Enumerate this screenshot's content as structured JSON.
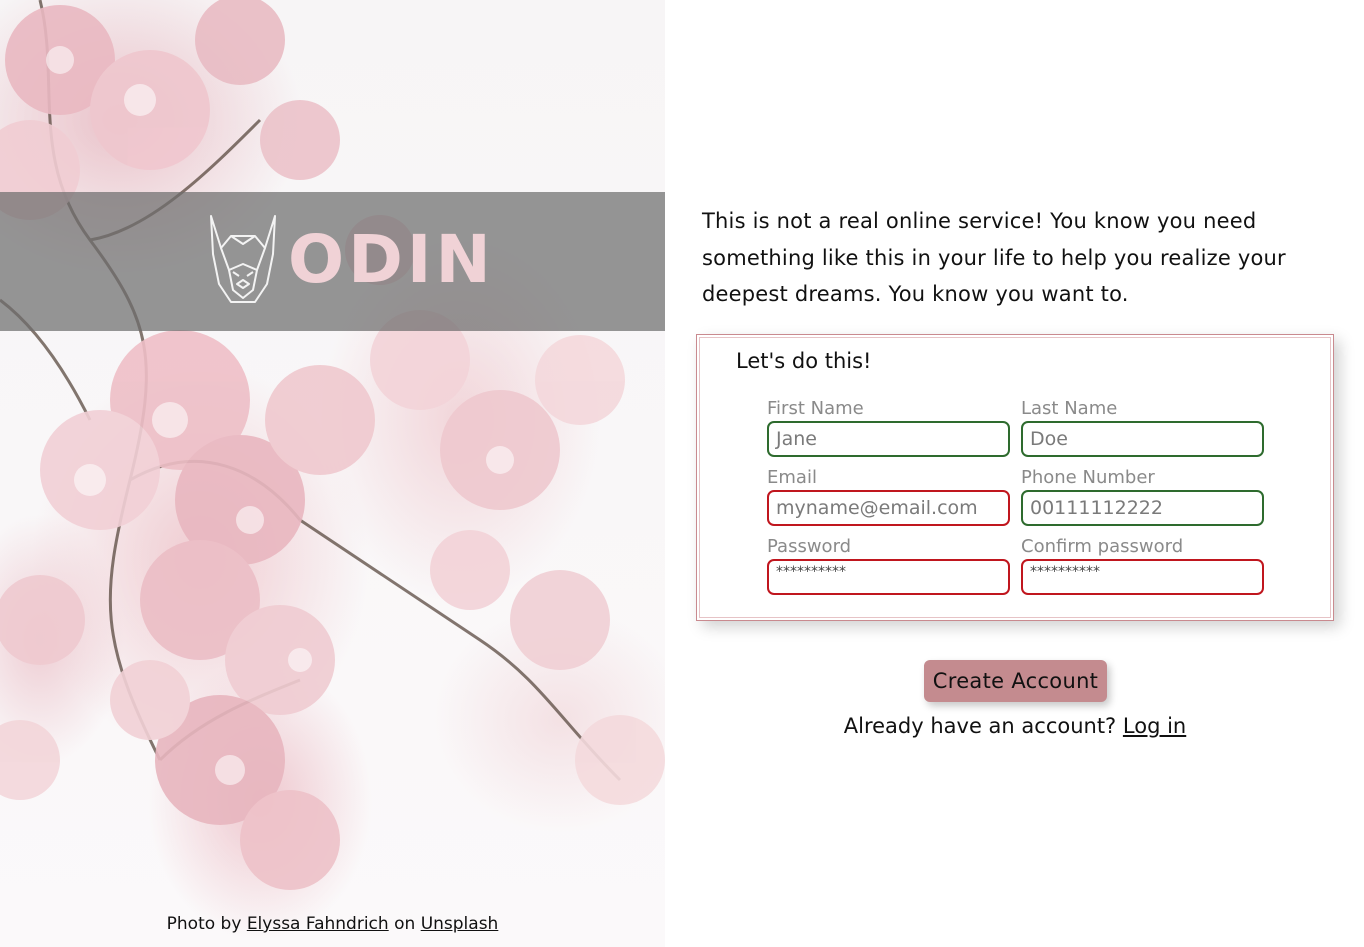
{
  "hero": {
    "brand": "ODIN",
    "credit": {
      "prefix": "Photo by",
      "photographer": "Elyssa Fahndrich",
      "middle": "on",
      "source": "Unsplash"
    }
  },
  "intro": {
    "text": "This is not a real online service! You know you need something like this in your life to help you realize your deepest dreams. You know you want to."
  },
  "form": {
    "legend": "Let's do this!",
    "fields": {
      "first_name": {
        "label": "First Name",
        "value": "Jane"
      },
      "last_name": {
        "label": "Last Name",
        "value": "Doe"
      },
      "email": {
        "label": "Email",
        "value": "myname@email.com"
      },
      "phone": {
        "label": "Phone Number",
        "value": "00111112222"
      },
      "password": {
        "label": "Password",
        "value": "**********"
      },
      "confirm_password": {
        "label": "Confirm password",
        "value": "**********"
      }
    }
  },
  "actions": {
    "create_account": "Create Account",
    "login_prompt": "Already have an account?",
    "login_link": "Log in"
  },
  "colors": {
    "valid_border": "#2e6b2e",
    "invalid_border": "#c0161e",
    "button": "#c48b8f",
    "brand_text": "#f0d2d6"
  }
}
